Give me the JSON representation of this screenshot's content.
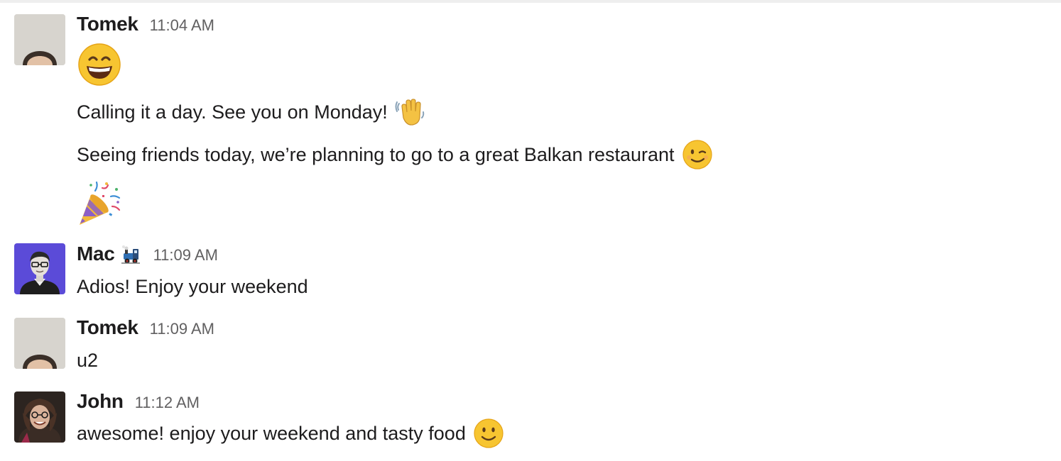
{
  "messages": [
    {
      "author": "Tomek",
      "time": "11:04 AM",
      "avatar_icon": "avatar-tomek",
      "lines": [
        {
          "text": "",
          "emoji": "grinning-face-icon"
        },
        {
          "text": "Calling it a day. See you on Monday!",
          "emoji": "waving-hand-icon"
        },
        {
          "text": "Seeing friends today, we’re planning to go to a great Balkan restaurant",
          "emoji": "winking-face-icon"
        },
        {
          "text": "",
          "emoji": "party-popper-icon"
        }
      ]
    },
    {
      "author": "Mac",
      "status_emoji": "steam-locomotive-icon",
      "time": "11:09 AM",
      "avatar_icon": "avatar-mac",
      "lines": [
        {
          "text": "Adios! Enjoy your weekend"
        }
      ]
    },
    {
      "author": "Tomek",
      "time": "11:09 AM",
      "avatar_icon": "avatar-tomek",
      "lines": [
        {
          "text": "u2"
        }
      ]
    },
    {
      "author": "John",
      "time": "11:12 AM",
      "avatar_icon": "avatar-john",
      "lines": [
        {
          "text": "awesome! enjoy your weekend and tasty food",
          "emoji": "slightly-smiling-face-icon"
        }
      ]
    }
  ],
  "colors": {
    "author": "#1d1c1d",
    "timestamp": "#616061",
    "mac_avatar_bg": "#5b4bd8"
  }
}
